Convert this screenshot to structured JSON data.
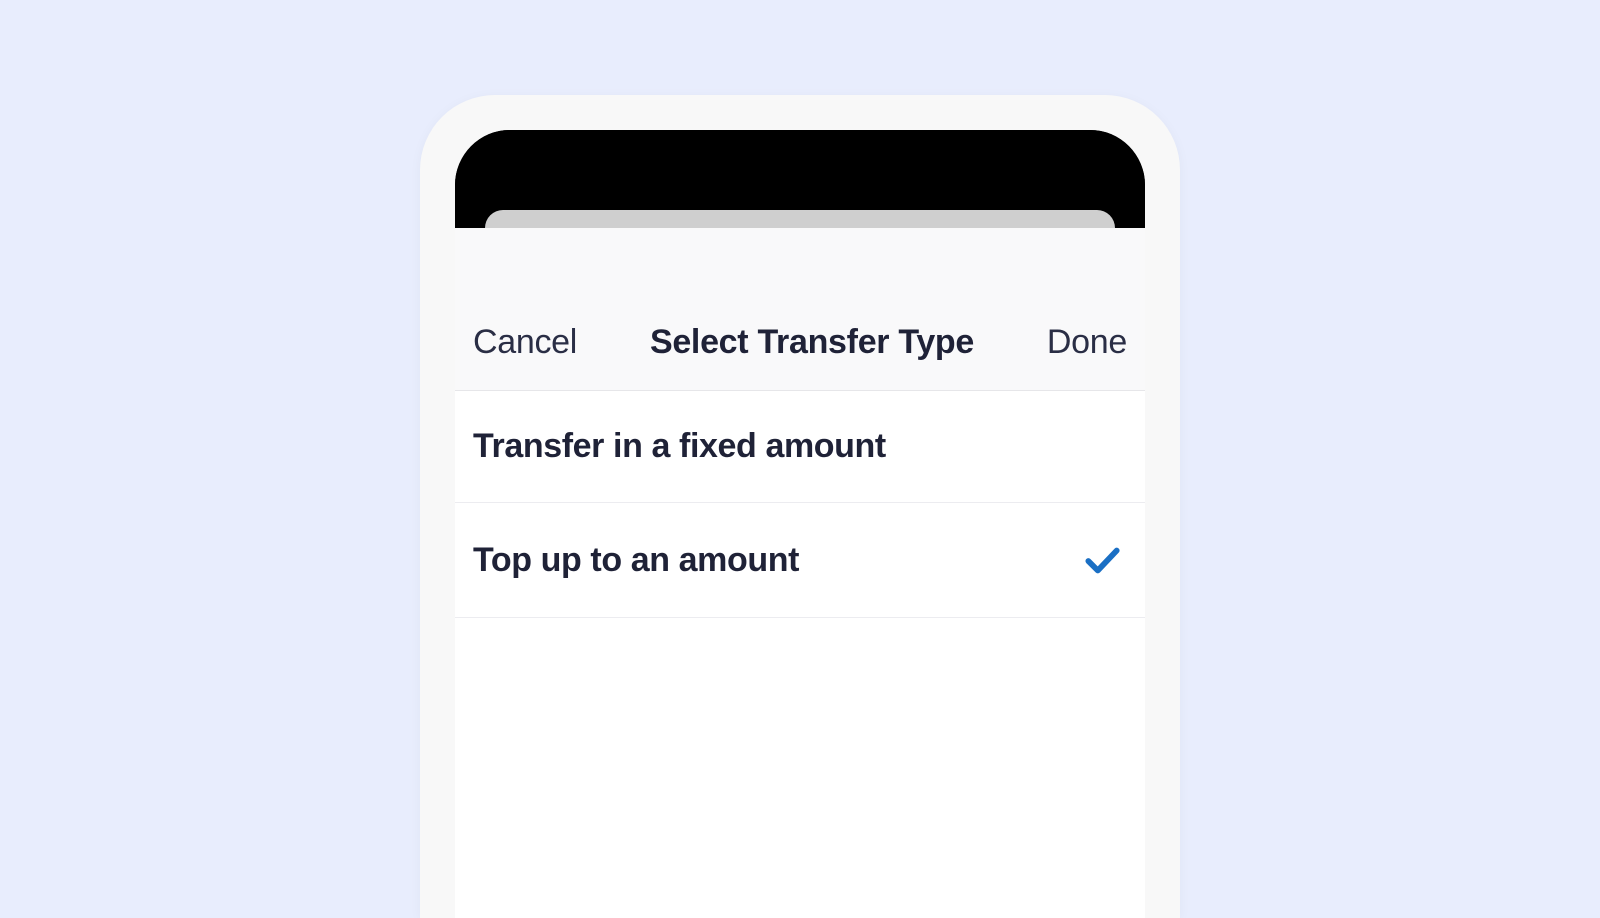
{
  "nav": {
    "cancel": "Cancel",
    "title": "Select Transfer Type",
    "done": "Done"
  },
  "options": [
    {
      "label": "Transfer in a fixed amount",
      "selected": false
    },
    {
      "label": "Top up to an amount",
      "selected": true
    }
  ],
  "colors": {
    "background": "#e8edfd",
    "accent": "#1a6fc4",
    "text": "#1f2237"
  }
}
